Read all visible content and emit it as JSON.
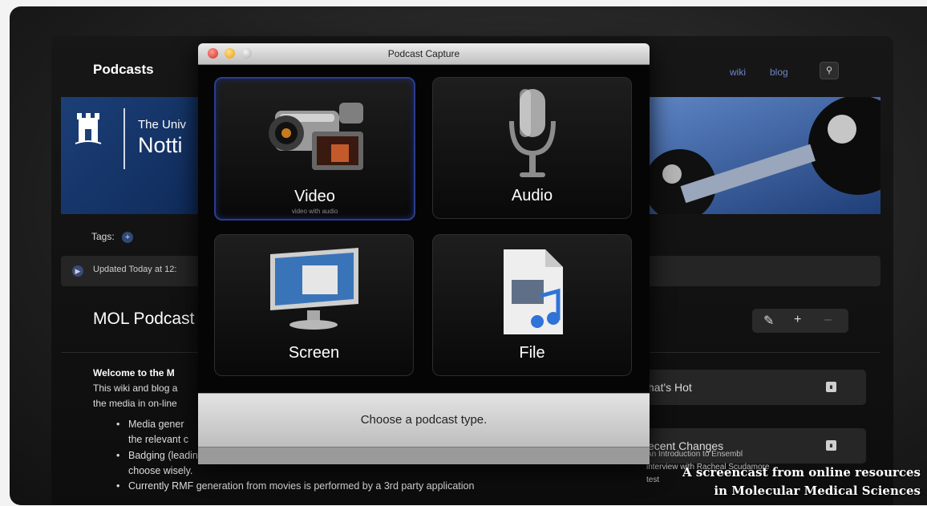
{
  "site": {
    "title": "Podcasts",
    "nav": [
      "wiki",
      "blog"
    ],
    "search_icon": "search-icon",
    "banner": {
      "line1": "The Univ",
      "line2": "Notti"
    },
    "tags_label": "Tags:",
    "updated_text": "Updated Today at 12:",
    "page_title": "MOL Podcast",
    "edit_tools": [
      "pencil-icon",
      "plus-icon",
      "minus-icon"
    ],
    "welcome_heading": "Welcome to the M",
    "desc_line1": "This wiki and blog a",
    "desc_line2": "the media in on-line",
    "bullets": [
      "Media gener",
      "the relevant c",
      "Badging (leading and trailing materials included with videos) is automatic if chosen, so",
      "choose wisely.",
      "Currently RMF generation from movies is performed by a 3rd party application"
    ],
    "sidebar": {
      "hot_label": "hat's Hot",
      "changes_label": "ecent Changes",
      "changes_items": [
        "An Introduction to Ensembl",
        "interview with Racheal Scudamore",
        "test"
      ]
    }
  },
  "dialog": {
    "title": "Podcast Capture",
    "tiles": [
      {
        "label": "Video",
        "sub": "video with audio",
        "icon": "video-camera-icon"
      },
      {
        "label": "Audio",
        "icon": "microphone-icon"
      },
      {
        "label": "Screen",
        "icon": "monitor-icon"
      },
      {
        "label": "File",
        "icon": "media-file-icon"
      }
    ],
    "prompt": "Choose a podcast type."
  },
  "caption": {
    "line1": "A screencast from online resources",
    "line2": "in Molecular Medical Sciences"
  }
}
